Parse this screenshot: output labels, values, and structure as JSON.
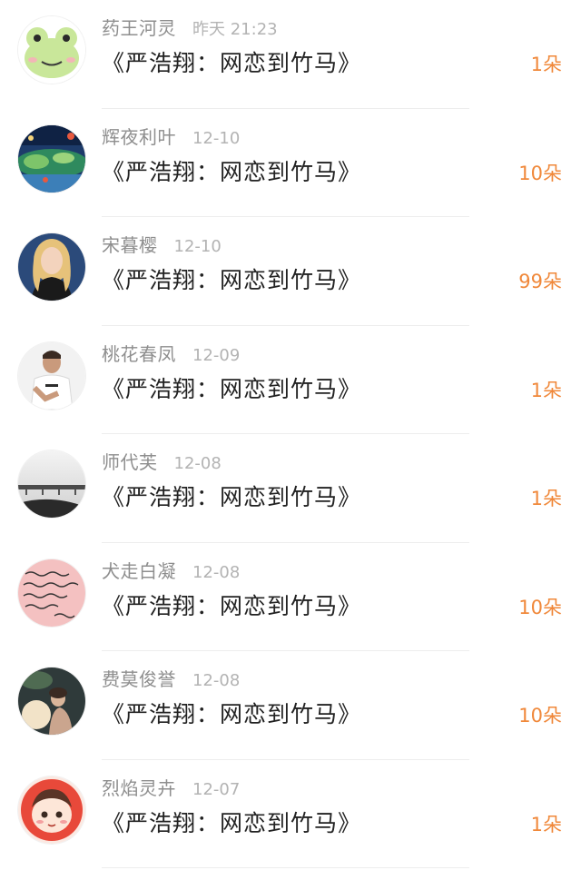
{
  "colors": {
    "name": "#8e8e8e",
    "time": "#b3b3b3",
    "title": "#222222",
    "count": "#f0883a",
    "divider": "#ededed"
  },
  "rows": [
    {
      "name": "药王河灵",
      "time": "昨天 21:23",
      "book": "《严浩翔：网恋到竹马》",
      "count": "1朵",
      "avatar": "frog-avatar"
    },
    {
      "name": "辉夜利叶",
      "time": "12-10",
      "book": "《严浩翔：网恋到竹马》",
      "count": "10朵",
      "avatar": "landscape-avatar"
    },
    {
      "name": "宋暮樱",
      "time": "12-10",
      "book": "《严浩翔：网恋到竹马》",
      "count": "99朵",
      "avatar": "blonde-girl-avatar"
    },
    {
      "name": "桃花春凤",
      "time": "12-09",
      "book": "《严浩翔：网恋到竹马》",
      "count": "1朵",
      "avatar": "man-photo-avatar"
    },
    {
      "name": "师代芙",
      "time": "12-08",
      "book": "《严浩翔：网恋到竹马》",
      "count": "1朵",
      "avatar": "bridge-avatar"
    },
    {
      "name": "犬走白凝",
      "time": "12-08",
      "book": "《严浩翔：网恋到竹马》",
      "count": "10朵",
      "avatar": "handwriting-avatar"
    },
    {
      "name": "费莫俊誉",
      "time": "12-08",
      "book": "《严浩翔：网恋到竹马》",
      "count": "10朵",
      "avatar": "moon-girl-avatar"
    },
    {
      "name": "烈焰灵卉",
      "time": "12-07",
      "book": "《严浩翔：网恋到竹马》",
      "count": "1朵",
      "avatar": "cartoon-girl-avatar"
    }
  ]
}
